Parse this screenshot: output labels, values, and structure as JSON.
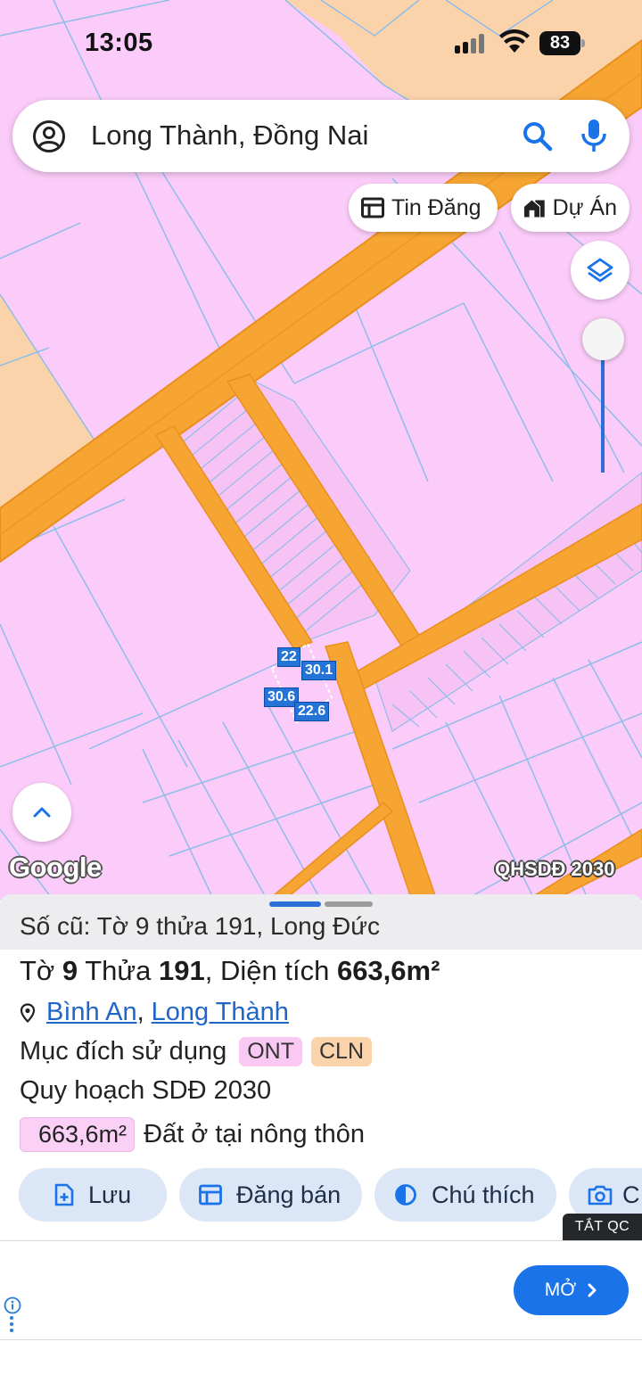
{
  "status_bar": {
    "time": "13:05",
    "battery": "83"
  },
  "search": {
    "query": "Long Thành, Đồng Nai"
  },
  "chips": {
    "listings": "Tin Đăng",
    "projects": "Dự Án"
  },
  "map": {
    "google": "Google",
    "plan_label": "QHSDĐ 2030",
    "dimensions": [
      "22",
      "30.1",
      "30.6",
      "22.6"
    ],
    "colors": {
      "residential_rural": "#fbccf9",
      "perennial": "#fbd3aa",
      "road": "#f6a532",
      "road_edge": "#e98f1c",
      "boundary": "#8fbde8"
    }
  },
  "sheet": {
    "old_id": "Số cũ: Tờ 9 thửa 191, Long Đức",
    "title": {
      "sheet_word": "Tờ",
      "sheet_no": "9",
      "plot_word": "Thửa",
      "plot_no": "191",
      "area_word": "Diện tích",
      "area_value": "663,6m²"
    },
    "location": {
      "ward": "Bình An",
      "sep": ",",
      "district": "Long Thành"
    },
    "usage": {
      "label": "Mục đích sử dụng",
      "tags": [
        "ONT",
        "CLN"
      ]
    },
    "plan": "Quy hoạch SDĐ 2030",
    "area_plan": {
      "value": "663,6m²",
      "type": "Đất ở tại nông thôn"
    },
    "actions": [
      {
        "label": "Lưu",
        "icon": "save-icon"
      },
      {
        "label": "Đăng bán",
        "icon": "listing-icon"
      },
      {
        "label": "Chú thích",
        "icon": "legend-icon"
      },
      {
        "label": "C",
        "icon": "camera-icon"
      }
    ]
  },
  "ad": {
    "close": "TẮT QC",
    "open": "MỞ"
  }
}
